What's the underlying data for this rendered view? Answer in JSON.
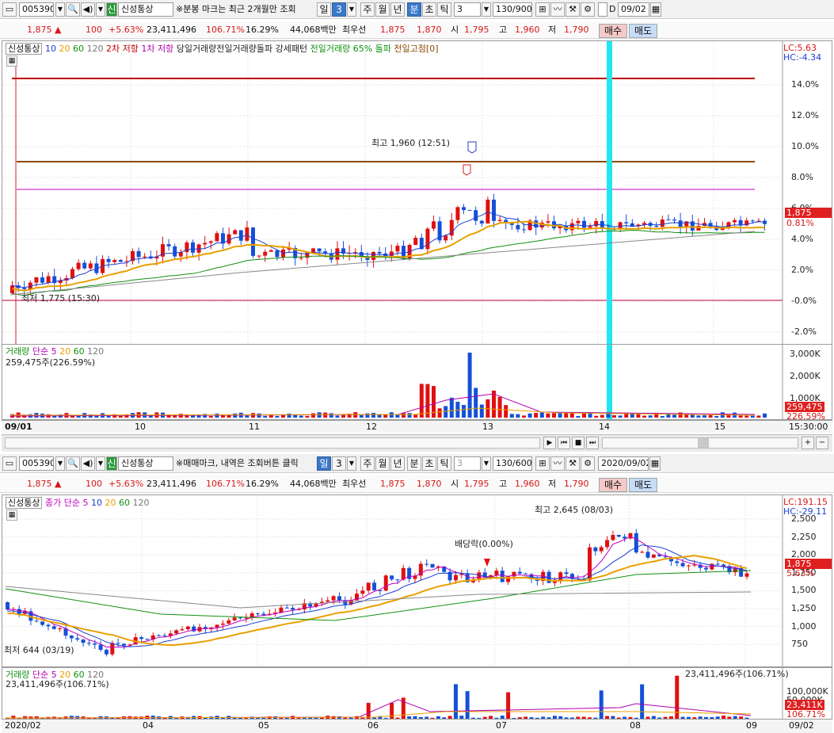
{
  "top": {
    "toolbar": {
      "code": "005390",
      "market_badge": "신",
      "name": "신성통상",
      "note": "※분봉 마크는 최근 2개월만 조회",
      "periods": [
        "일",
        "3",
        "주",
        "월",
        "년",
        "분",
        "초",
        "틱",
        "3"
      ],
      "count": "130/900",
      "check_label": "D",
      "date": "09/02"
    },
    "quote": {
      "price": "1,875 ▲",
      "change": "100",
      "change_pct": "+5.63%",
      "volume": "23,411,496",
      "volume_ratio": "106.71%",
      "turnover": "16.29%",
      "amount": "44,068백만",
      "best_label": "최우선",
      "ask": "1,875",
      "bid": "1,870",
      "open_label": "시",
      "open": "1,795",
      "high_label": "고",
      "high": "1,960",
      "low_label": "저",
      "low": "1,790",
      "buy": "매수",
      "sell": "매도"
    },
    "legend": [
      {
        "text": "신성통상",
        "color": "#222222"
      },
      {
        "text": "10",
        "color": "#1a3fd0"
      },
      {
        "text": "20",
        "color": "#e8a000"
      },
      {
        "text": "60",
        "color": "#129012"
      },
      {
        "text": "120",
        "color": "#777777"
      },
      {
        "text": "2차 저항",
        "color": "#c00000"
      },
      {
        "text": "1차 저항",
        "color": "#b000b0"
      },
      {
        "text": "당일거래량전일거래량돌파 강세패턴",
        "color": "#222222"
      },
      {
        "text": "전일거래량 65% 돌파",
        "color": "#129012"
      },
      {
        "text": "전일고점[0]",
        "color": "#8a4a00"
      }
    ],
    "lc": "LC:5.63",
    "hc": "HC:-4.34",
    "y_ticks": [
      "14.0%",
      "12.0%",
      "10.0%",
      "8.0%",
      "6.0%",
      "4.0%",
      "2.0%",
      "-0.0%",
      "-2.0%"
    ],
    "price_tag": "1,875",
    "pct_tag": "0.81%",
    "high_annot": "최고 1,960 (12:51)",
    "low_annot": "최저 1,775 (15:30)",
    "vol_legend": [
      "거래량",
      "단순",
      "5",
      "20",
      "60",
      "120"
    ],
    "vol_value": "259,475주(226.59%)",
    "vol_ticks": [
      "3,000K",
      "2,000K",
      "1,000K"
    ],
    "vol_tag": "259,475",
    "vol_tag2": "226.59%",
    "x_labels": [
      "09/01",
      "10",
      "11",
      "12",
      "13",
      "14",
      "15"
    ],
    "time_label": "15:30:00"
  },
  "bottom": {
    "toolbar": {
      "code": "005390",
      "market_badge": "신",
      "name": "신성통상",
      "note": "※매매마크, 내역은 조회버튼 클릭",
      "periods": [
        "일",
        "3",
        "주",
        "월",
        "년",
        "분",
        "초",
        "틱",
        "3"
      ],
      "count": "130/600",
      "date": "2020/09/02"
    },
    "quote": {
      "price": "1,875 ▲",
      "change": "100",
      "change_pct": "+5.63%",
      "volume": "23,411,496",
      "volume_ratio": "106.71%",
      "turnover": "16.29%",
      "amount": "44,068백만",
      "best_label": "최우선",
      "ask": "1,875",
      "bid": "1,870",
      "open_label": "시",
      "open": "1,795",
      "high_label": "고",
      "high": "1,960",
      "low_label": "저",
      "low": "1,790",
      "buy": "매수",
      "sell": "매도"
    },
    "legend": [
      {
        "text": "신성통상",
        "color": "#222222"
      },
      {
        "text": "종가 단순 5",
        "color": "#c000c0"
      },
      {
        "text": "10",
        "color": "#1a3fd0"
      },
      {
        "text": "20",
        "color": "#e8a000"
      },
      {
        "text": "60",
        "color": "#129012"
      },
      {
        "text": "120",
        "color": "#777777"
      }
    ],
    "lc": "LC:191.15",
    "hc": "HC:-29.11",
    "y_ticks": [
      "2,500",
      "2,250",
      "2,000",
      "1,750",
      "1,500",
      "1,250",
      "1,000",
      "750"
    ],
    "price_tag": "1,875",
    "pct_tag": "5.63%",
    "high_annot": "최고 2,645 (08/03)",
    "low_annot": "최저 644 (03/19)",
    "div_annot": "배당락(0.00%)",
    "vol_legend": [
      "거래량",
      "단순",
      "5",
      "20",
      "60",
      "120"
    ],
    "vol_value": "23,411,496주(106.71%)",
    "vol_value_right": "23,411,496주(106.71%)",
    "vol_ticks": [
      "100,000K",
      "50,000K"
    ],
    "vol_tag": "23,411K",
    "vol_tag2": "106.71%",
    "x_labels": [
      "2020/02",
      "04",
      "05",
      "06",
      "07",
      "08",
      "09"
    ],
    "date_label": "09/02"
  },
  "colors": {
    "up": "#e01010",
    "down": "#1450d8",
    "accent": "#3a78c8",
    "cyan_marker": "#22e6f0"
  },
  "icons": [
    "chart-icon",
    "search-icon",
    "speaker-icon",
    "config-icon",
    "prev-icon",
    "next-icon",
    "stop-icon"
  ]
}
